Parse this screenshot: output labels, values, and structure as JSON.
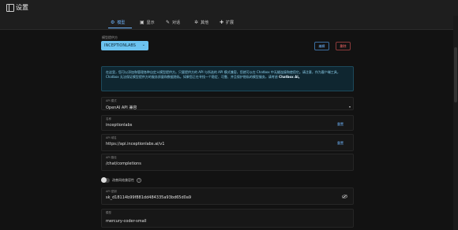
{
  "app": {
    "title": "设置"
  },
  "tabs": [
    {
      "label": "模型",
      "icon": "model-icon",
      "glyph": "⚙"
    },
    {
      "label": "显示",
      "icon": "display-icon",
      "glyph": "▣"
    },
    {
      "label": "对话",
      "icon": "chat-icon",
      "glyph": "✎"
    },
    {
      "label": "其他",
      "icon": "gear-icon",
      "glyph": "✲"
    },
    {
      "label": "扩展",
      "icon": "puzzle-icon",
      "glyph": "✚"
    }
  ],
  "provider": {
    "label": "模型提供方",
    "selected": "INCEPTIONLABS",
    "edit_label": "编辑",
    "delete_label": "删除"
  },
  "notice": {
    "text": "在这里，您可以添加和管理各种自定义模型提供方。只要提供方的 API 与所选的 API 模式兼容，您就可以在 Chatbox 中无缝连接和使用它。请注意，作为客户端工具，Chatbox 无法保证模型提供方的服务质量和数据隐私。如果您正在寻找一个稳定、可靠、并且保护隐私的模型服务，请考虑",
    "highlight": "Chatbox AI。"
  },
  "fields": {
    "api_mode": {
      "label": "API 模式",
      "value": "OpenAI API 兼容"
    },
    "name": {
      "label": "名称",
      "value": "inceptionlabs",
      "reset": "重置"
    },
    "api_host": {
      "label": "API 域名",
      "value": "https://api.inceptionlabs.ai/v1",
      "reset": "重置"
    },
    "api_path": {
      "label": "API 路径",
      "value": "/chat/completions"
    },
    "api_key": {
      "label": "API 密钥",
      "value": "sk_d18114b99f881dd484335a93bd65d0a9"
    },
    "model": {
      "label": "模型",
      "value": "mercury-coder-small"
    }
  },
  "proxy_toggle": {
    "label": "改善网络兼容性",
    "on": false
  },
  "colors": {
    "accent": "#6fb6ff",
    "select_bg": "#6cc3f0",
    "danger": "#ff6b6b",
    "notice_text": "#8fd3ef"
  }
}
